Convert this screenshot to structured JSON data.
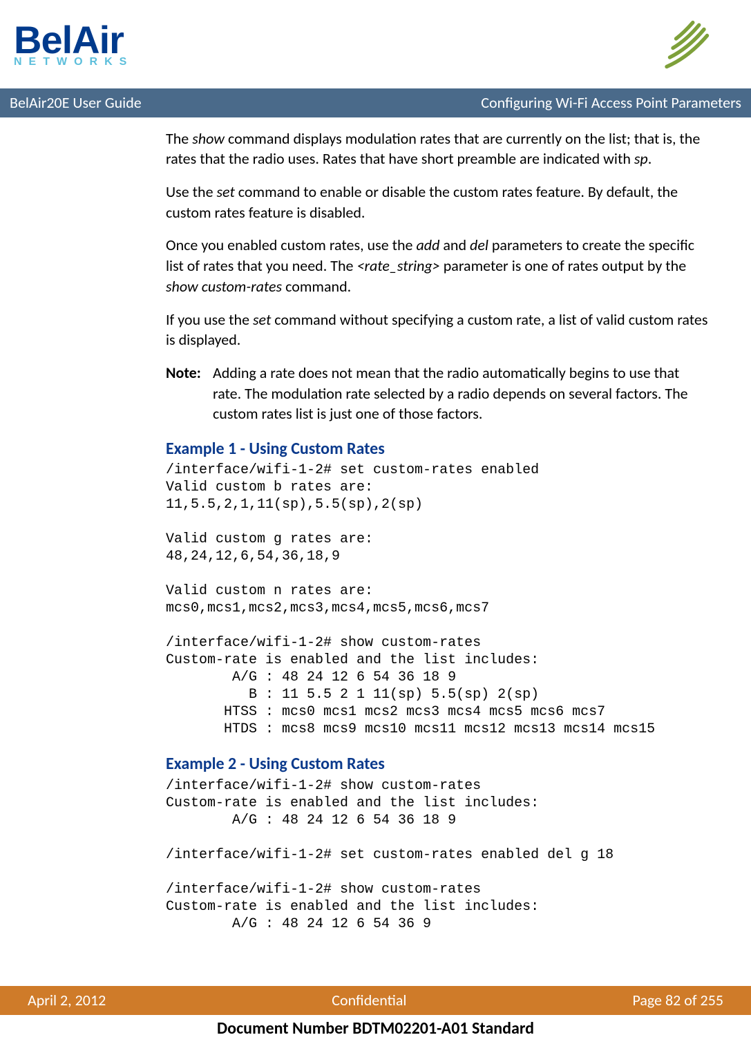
{
  "logo": {
    "brand": "BelAir",
    "sub": "NETWORKS"
  },
  "titlebar": {
    "left": "BelAir20E User Guide",
    "right": "Configuring Wi-Fi Access Point Parameters"
  },
  "p1": {
    "a": "The ",
    "b": "show",
    "c": " command displays modulation rates that are currently on the list; that is, the rates that the radio uses. Rates that have short preamble are indicated with ",
    "d": "sp",
    "e": "."
  },
  "p2": {
    "a": "Use the ",
    "b": "set",
    "c": " command to enable or disable the custom rates feature. By default, the custom rates feature is disabled."
  },
  "p3": {
    "a": "Once you enabled custom rates, use the ",
    "b": "add",
    "c": " and ",
    "d": "del",
    "e": " parameters to create the specific list of rates that you need. The ",
    "f": "<rate_string>",
    "g": " parameter is one of rates output by the ",
    "h": "show custom-rates",
    "i": " command."
  },
  "p4": {
    "a": "If you use the ",
    "b": "set",
    "c": " command without specifying a custom rate, a list of valid custom rates is displayed."
  },
  "note": {
    "label": "Note:",
    "body": "Adding a rate does not mean that the radio automatically begins to use that rate. The modulation rate selected by a radio depends on several factors. The custom rates list is just one of those factors."
  },
  "ex1": {
    "title": "Example 1 - Using Custom Rates",
    "code": "/interface/wifi-1-2# set custom-rates enabled\nValid custom b rates are:\n11,5.5,2,1,11(sp),5.5(sp),2(sp)\n\nValid custom g rates are:\n48,24,12,6,54,36,18,9\n\nValid custom n rates are:\nmcs0,mcs1,mcs2,mcs3,mcs4,mcs5,mcs6,mcs7\n\n/interface/wifi-1-2# show custom-rates\nCustom-rate is enabled and the list includes:\n        A/G : 48 24 12 6 54 36 18 9\n          B : 11 5.5 2 1 11(sp) 5.5(sp) 2(sp)\n       HTSS : mcs0 mcs1 mcs2 mcs3 mcs4 mcs5 mcs6 mcs7\n       HTDS : mcs8 mcs9 mcs10 mcs11 mcs12 mcs13 mcs14 mcs15"
  },
  "ex2": {
    "title": "Example 2 - Using Custom Rates",
    "code": "/interface/wifi-1-2# show custom-rates\nCustom-rate is enabled and the list includes:\n        A/G : 48 24 12 6 54 36 18 9\n\n/interface/wifi-1-2# set custom-rates enabled del g 18\n\n/interface/wifi-1-2# show custom-rates\nCustom-rate is enabled and the list includes:\n        A/G : 48 24 12 6 54 36 9"
  },
  "footer": {
    "left": "April 2, 2012",
    "center": "Confidential",
    "right": "Page 82 of 255"
  },
  "docnum": "Document Number BDTM02201-A01 Standard"
}
